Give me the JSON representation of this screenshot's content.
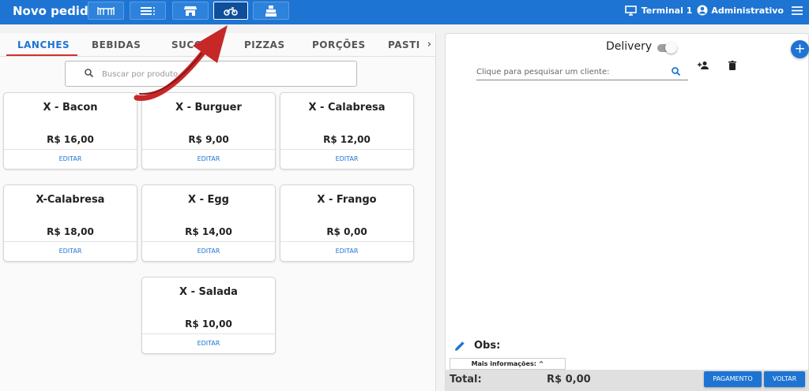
{
  "header": {
    "title": "Novo pedido",
    "toolbar_buttons": [
      {
        "icon": "tables-icon"
      },
      {
        "icon": "list-icon"
      },
      {
        "icon": "store-icon"
      },
      {
        "icon": "motorcycle-icon",
        "active": true
      },
      {
        "icon": "cash-register-icon"
      }
    ],
    "terminal": "Terminal 1",
    "user": "Administrativo"
  },
  "tabs": [
    {
      "label": "LANCHES",
      "active": true
    },
    {
      "label": "BEBIDAS"
    },
    {
      "label": "SUCOS"
    },
    {
      "label": "PIZZAS"
    },
    {
      "label": "PORÇÕES"
    },
    {
      "label": "PASTI"
    }
  ],
  "search": {
    "placeholder": "Buscar por produto..."
  },
  "products": [
    {
      "name": "X - Bacon",
      "price": "R$ 16,00",
      "edit": "EDITAR"
    },
    {
      "name": "X - Burguer",
      "price": "R$ 9,00",
      "edit": "EDITAR"
    },
    {
      "name": "X - Calabresa",
      "price": "R$ 12,00",
      "edit": "EDITAR"
    },
    {
      "name": "X-Calabresa",
      "price": "R$ 18,00",
      "edit": "EDITAR"
    },
    {
      "name": "X - Egg",
      "price": "R$ 14,00",
      "edit": "EDITAR"
    },
    {
      "name": "X - Frango",
      "price": "R$ 0,00",
      "edit": "EDITAR"
    },
    {
      "name": "X - Salada",
      "price": "R$ 10,00",
      "edit": "EDITAR"
    }
  ],
  "order": {
    "delivery_label": "Delivery",
    "delivery_on": false,
    "client_placeholder": "Clique para pesquisar um cliente:",
    "obs_label": "Obs:",
    "more_info": "Mais informações:",
    "total_label": "Total:",
    "total_value": "R$ 0,00",
    "pay_button": "PAGAMENTO",
    "back_button": "VOLTAR"
  },
  "colors": {
    "primary": "#1e74d2",
    "annotation_arrow": "#c62828"
  }
}
